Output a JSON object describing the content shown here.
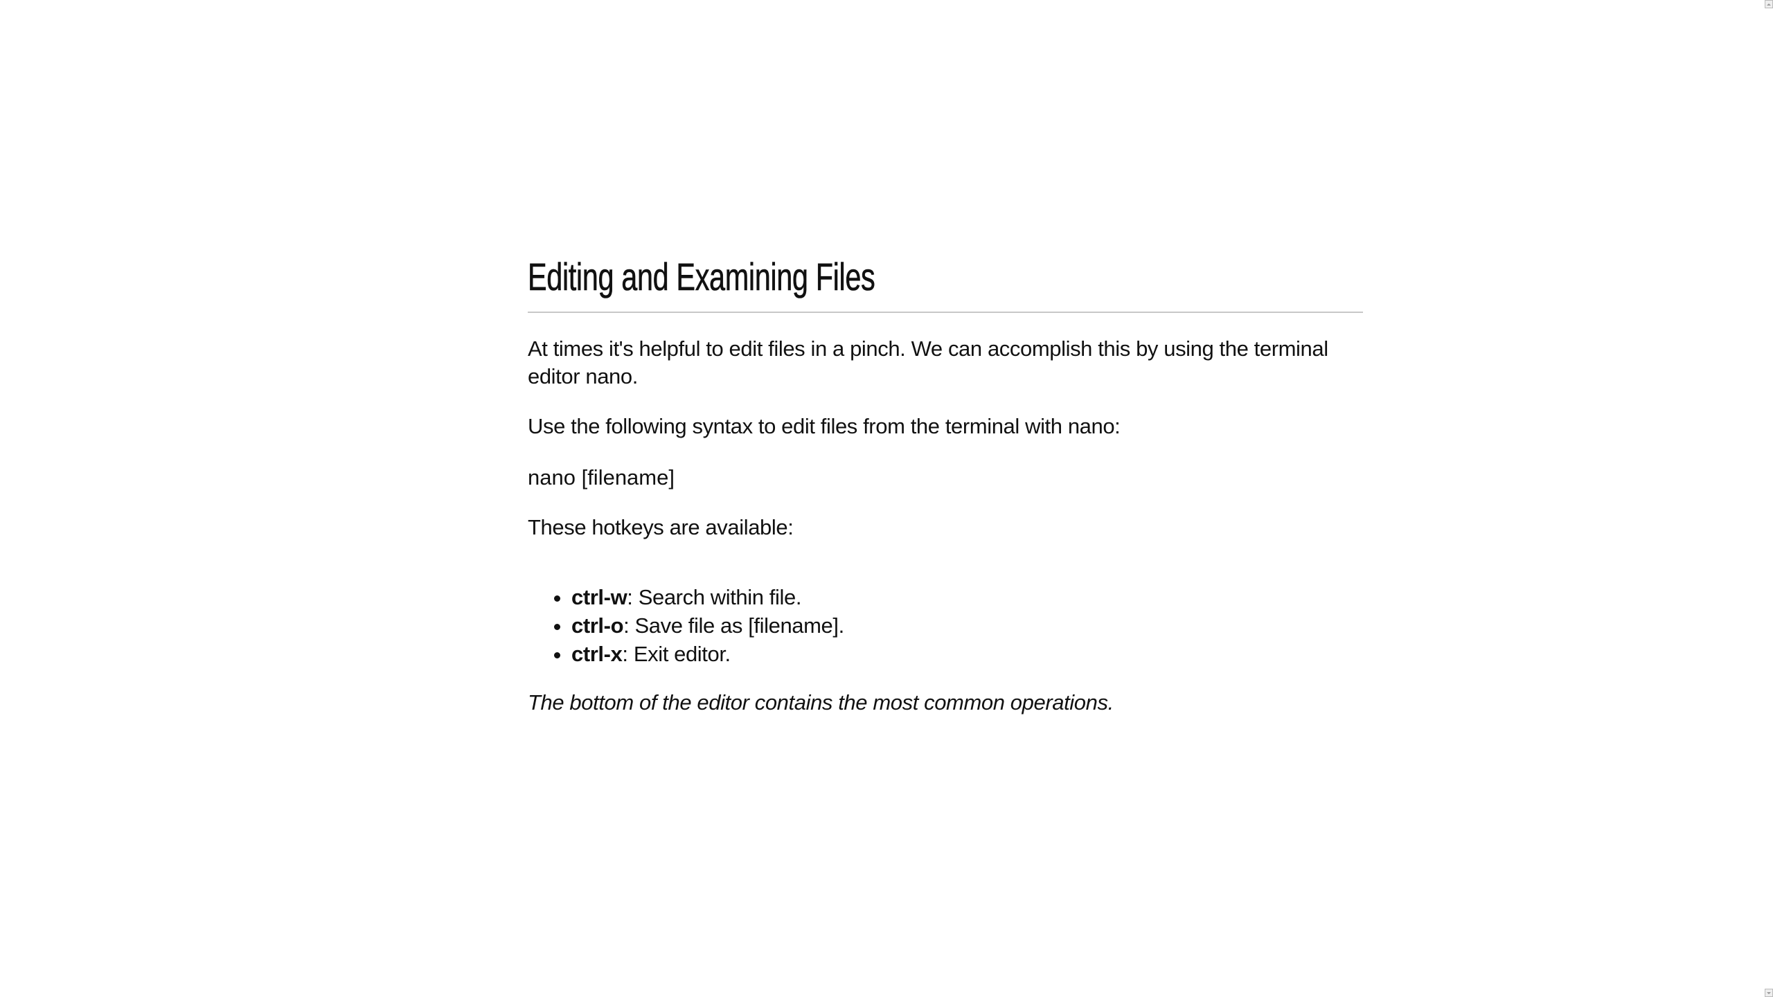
{
  "title": "Editing and Examining Files",
  "paragraphs": {
    "intro": "At times it's helpful to edit files in a pinch. We can accomplish this by using the terminal editor nano.",
    "syntax_intro": "Use the following syntax to edit files from the terminal with nano:",
    "syntax": "nano [filename]",
    "hotkeys_intro": "These hotkeys are available:",
    "note": "The bottom of the editor contains the most common operations."
  },
  "hotkeys": [
    {
      "key": "ctrl-w",
      "desc": ": Search within file."
    },
    {
      "key": "ctrl-o",
      "desc": ": Save file as [filename]."
    },
    {
      "key": "ctrl-x",
      "desc": ": Exit editor."
    }
  ]
}
